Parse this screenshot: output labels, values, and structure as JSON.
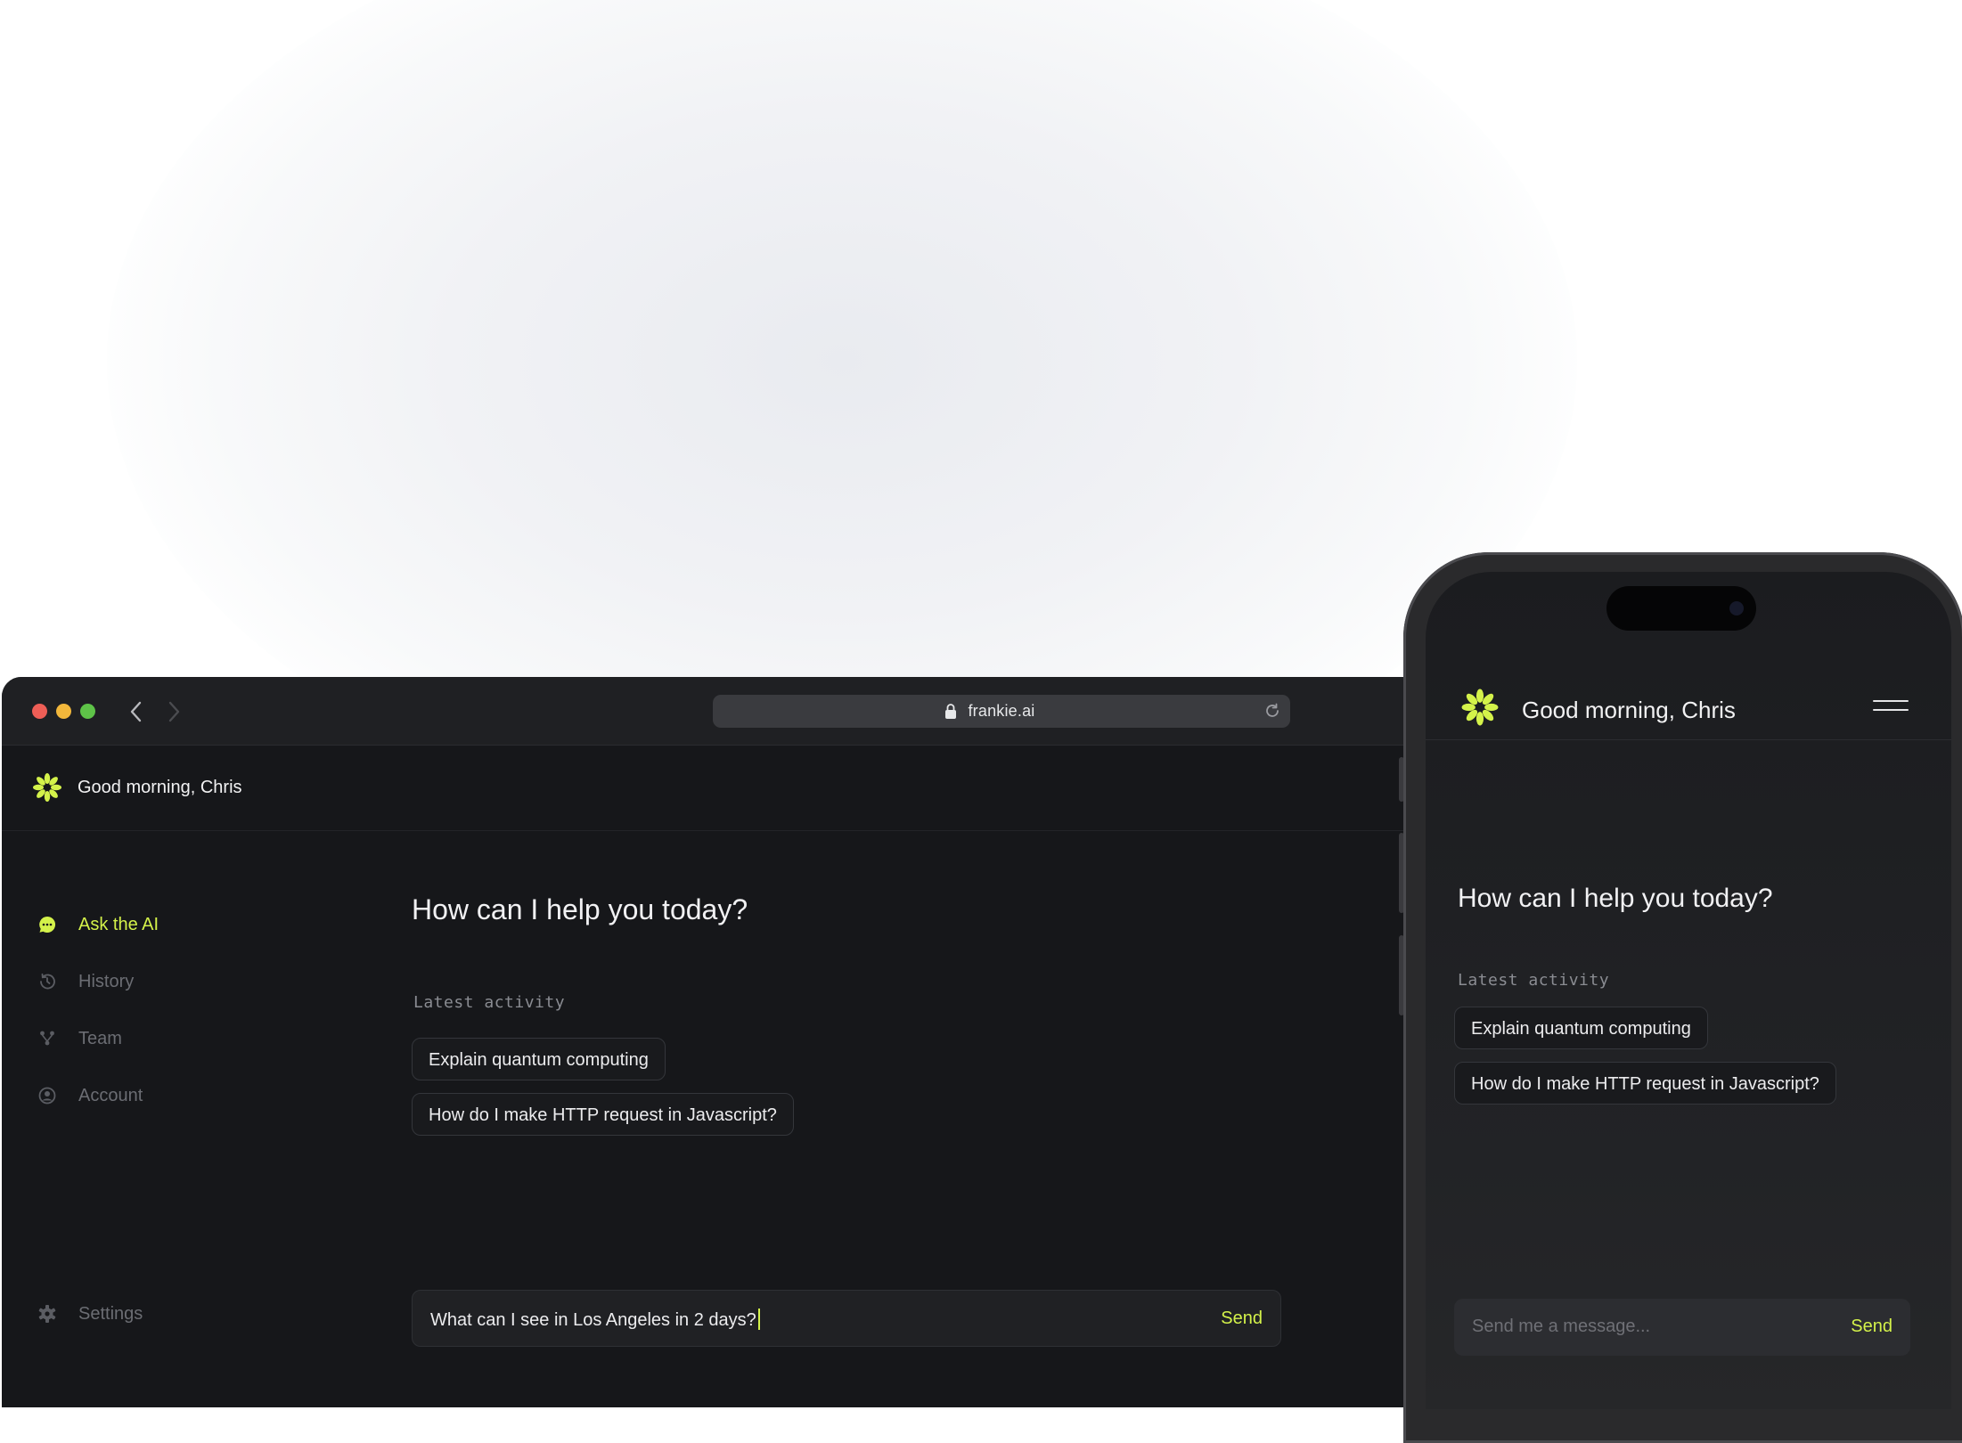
{
  "colors": {
    "accent": "#d4f24a",
    "background": "#16171a"
  },
  "browser": {
    "url": "frankie.ai",
    "traffic_lights": [
      "#ee5e56",
      "#f2b73b",
      "#5ec348"
    ]
  },
  "app": {
    "greeting": "Good morning, Chris",
    "nav": [
      {
        "label": "Ask the AI",
        "icon": "chat-bubble-icon",
        "active": true
      },
      {
        "label": "History",
        "icon": "history-icon",
        "active": false
      },
      {
        "label": "Team",
        "icon": "team-icon",
        "active": false
      },
      {
        "label": "Account",
        "icon": "account-icon",
        "active": false
      }
    ],
    "settings_label": "Settings",
    "title": "How can I help you today?",
    "activity_label": "Latest activity",
    "activity": [
      "Explain quantum computing",
      "How do I make HTTP request in Javascript?"
    ],
    "input_value": "What can I see in Los Angeles in 2 days?",
    "send_label": "Send"
  },
  "phone": {
    "greeting": "Good morning, Chris",
    "title": "How can I help you today?",
    "activity_label": "Latest activity",
    "activity": [
      "Explain quantum computing",
      "How do I make HTTP request in Javascript?"
    ],
    "input_placeholder": "Send me a message...",
    "send_label": "Send"
  }
}
